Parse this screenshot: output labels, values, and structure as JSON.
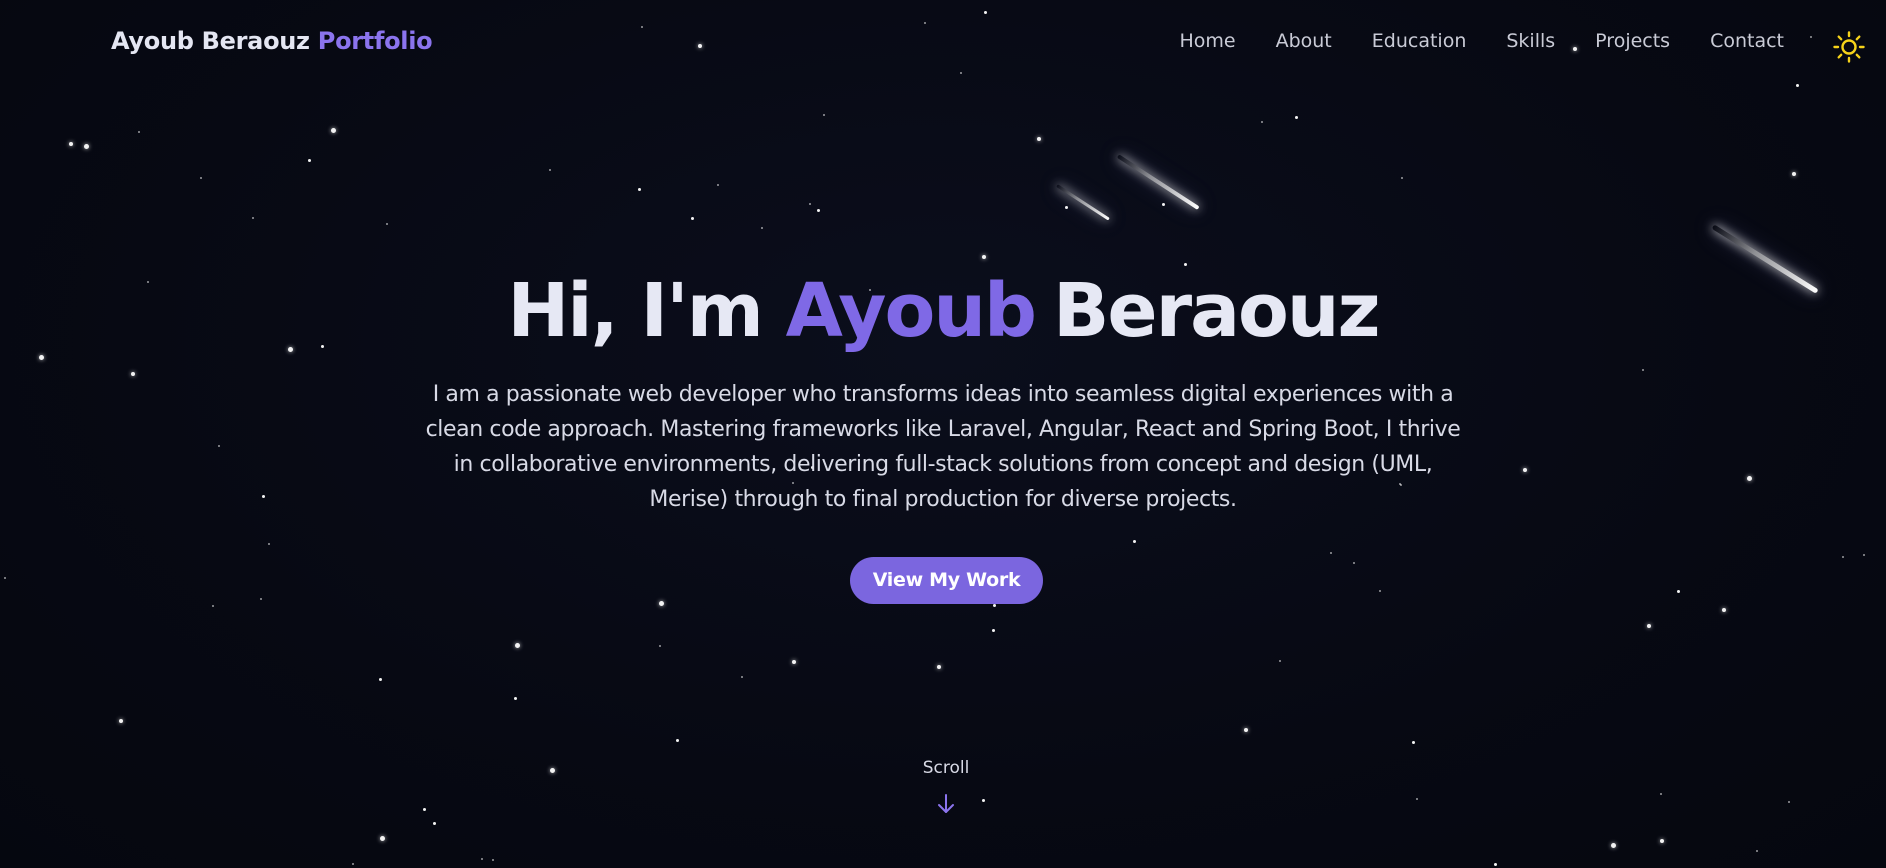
{
  "brand": {
    "name": "Ayoub Beraouz",
    "accent": "Portfolio"
  },
  "nav": {
    "links": [
      "Home",
      "About",
      "Education",
      "Skills",
      "Projects",
      "Contact"
    ],
    "theme_toggle_icon": "sun-icon"
  },
  "hero": {
    "greeting": "Hi, I'm",
    "first_name": "Ayoub",
    "last_name": "Beraouz",
    "description": "I am a passionate web developer who transforms ideas into seamless digital experiences with a clean code approach. Mastering frameworks like Laravel, Angular, React and Spring Boot, I thrive in collaborative environments, delivering full-stack solutions from concept and design (UML, Merise) through to final production for diverse projects.",
    "cta_label": "View My Work"
  },
  "scroll": {
    "label": "Scroll",
    "icon": "arrow-down-icon"
  },
  "colors": {
    "background": "#070913",
    "accent": "#7f69e6",
    "button": "#7b66df",
    "text": "#e6e8f4",
    "sun": "#f5d21a"
  }
}
